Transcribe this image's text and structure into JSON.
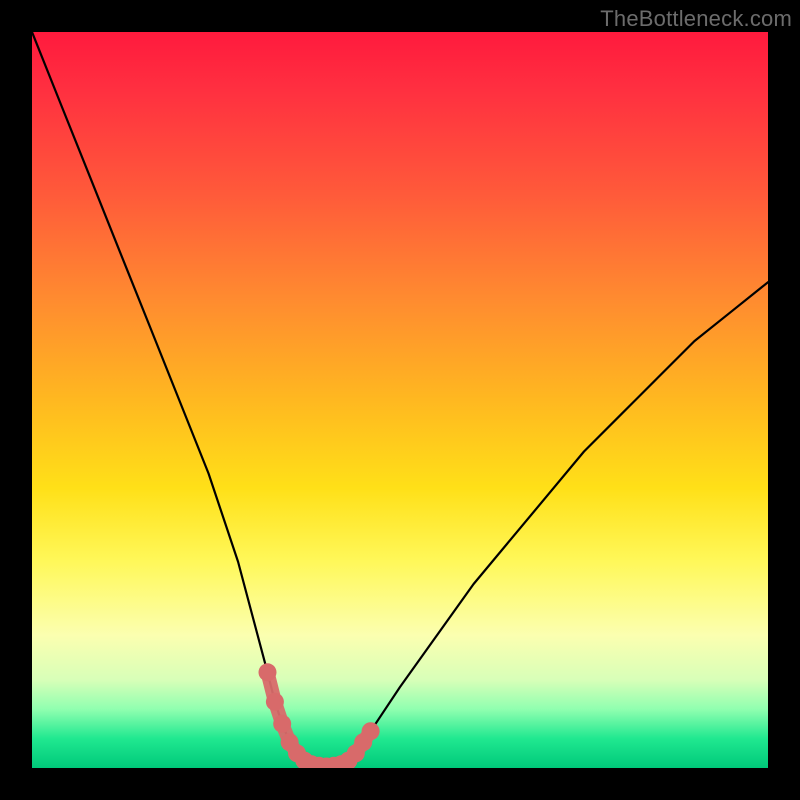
{
  "watermark": {
    "text": "TheBottleneck.com"
  },
  "chart_data": {
    "type": "line",
    "title": "",
    "xlabel": "",
    "ylabel": "",
    "xlim": [
      0,
      100
    ],
    "ylim": [
      0,
      100
    ],
    "grid": false,
    "legend": {
      "position": "none"
    },
    "series": [
      {
        "name": "curve",
        "x": [
          0,
          4,
          8,
          12,
          16,
          20,
          24,
          28,
          32,
          33,
          34,
          35,
          36,
          37,
          38,
          39,
          40,
          41,
          42,
          43,
          44,
          45,
          46,
          50,
          55,
          60,
          65,
          70,
          75,
          80,
          85,
          90,
          95,
          100
        ],
        "values": [
          100,
          90,
          80,
          70,
          60,
          50,
          40,
          28,
          13,
          9,
          6,
          3.5,
          2,
          1,
          0.5,
          0.3,
          0.2,
          0.3,
          0.5,
          1,
          2,
          3.5,
          5,
          11,
          18,
          25,
          31,
          37,
          43,
          48,
          53,
          58,
          62,
          66
        ]
      }
    ],
    "highlight": {
      "name": "bottom-marker",
      "color": "#d86a6a",
      "x": [
        32,
        33,
        34,
        35,
        36,
        37,
        38,
        39,
        40,
        41,
        42,
        43,
        44,
        45,
        46
      ],
      "values": [
        13,
        9,
        6,
        3.5,
        2,
        1,
        0.5,
        0.3,
        0.2,
        0.3,
        0.5,
        1,
        2,
        3.5,
        5
      ]
    },
    "background_gradient": {
      "direction": "vertical",
      "stops": [
        {
          "pos": 0,
          "color": "#ff1a3d"
        },
        {
          "pos": 50,
          "color": "#ffb820"
        },
        {
          "pos": 72,
          "color": "#fff85a"
        },
        {
          "pos": 100,
          "color": "#00c97a"
        }
      ]
    }
  }
}
